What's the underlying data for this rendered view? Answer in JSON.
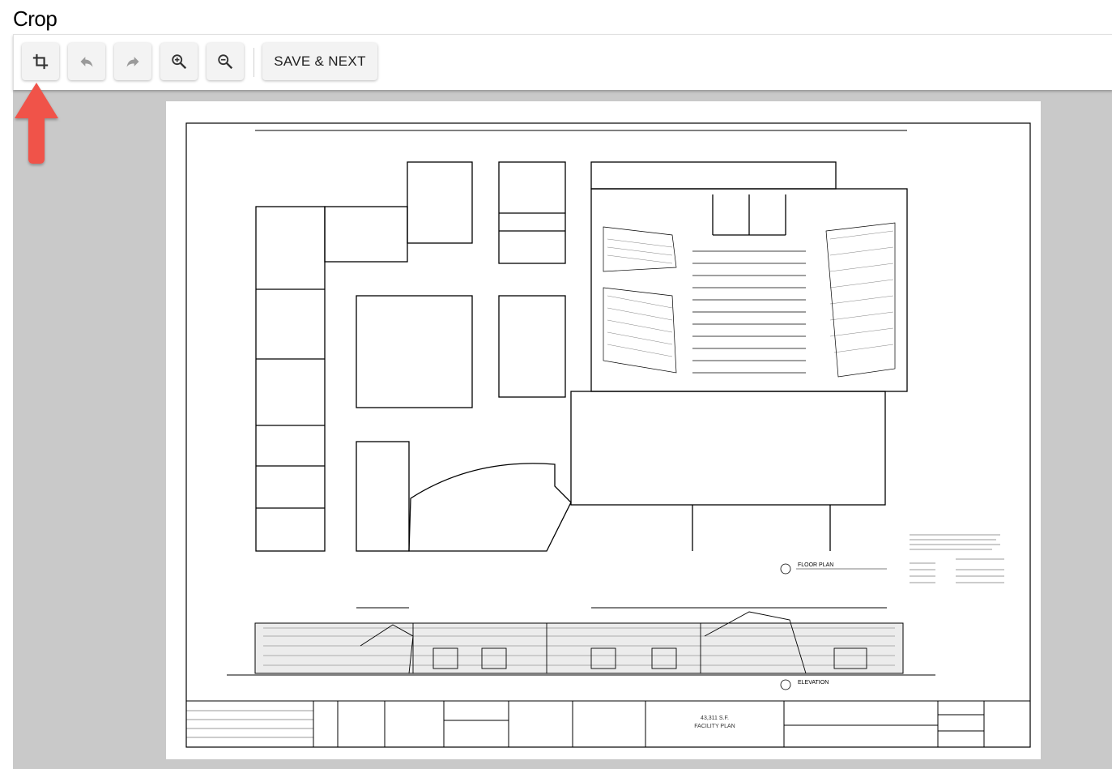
{
  "page": {
    "title": "Crop"
  },
  "toolbar": {
    "buttons": [
      {
        "name": "crop",
        "icon": "crop-icon"
      },
      {
        "name": "undo",
        "icon": "undo-icon"
      },
      {
        "name": "redo",
        "icon": "redo-icon"
      },
      {
        "name": "zoom-in",
        "icon": "zoom-in-icon"
      },
      {
        "name": "zoom-out",
        "icon": "zoom-out-icon"
      }
    ],
    "save_label": "SAVE & NEXT"
  },
  "document": {
    "title_block": {
      "area": "43,311 S.F.",
      "sheet_name": "FACILITY PLAN"
    },
    "floor_plan_label": "FLOOR PLAN",
    "elevation_label": "ELEVATION"
  },
  "colors": {
    "canvas_bg": "#c9c9c9",
    "button_bg": "#f3f3f3",
    "arrow": "#f0524a"
  }
}
